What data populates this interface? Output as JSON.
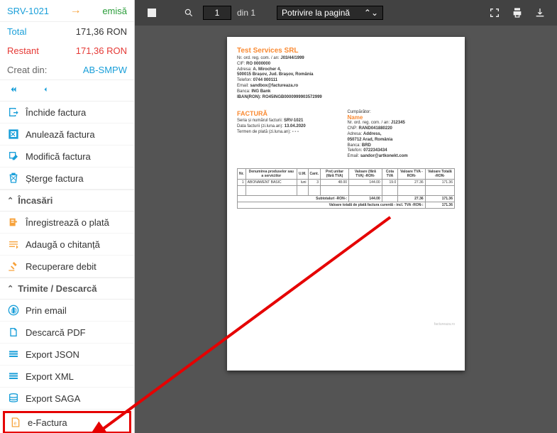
{
  "sidebar": {
    "header": {
      "invoice_no": "SRV-1021",
      "status": "emisă"
    },
    "totals": {
      "total_label": "Total",
      "total_value": "171,36 RON",
      "restant_label": "Restant",
      "restant_value": "171,36 RON",
      "created_label": "Creat din:",
      "created_value": "AB-SMPW"
    },
    "actions": {
      "close": "Închide factura",
      "cancel": "Anulează factura",
      "modify": "Modifică factura",
      "delete": "Șterge factura"
    },
    "section_payments": {
      "title": "Încasări",
      "register": "Înregistrează o plată",
      "receipt": "Adaugă o chitanță",
      "debit": "Recuperare debit"
    },
    "section_send": {
      "title": "Trimite / Descarcă",
      "email": "Prin email",
      "pdf": "Descarcă PDF",
      "json": "Export JSON",
      "xml": "Export XML",
      "saga": "Export SAGA",
      "efactura": "e-Factura"
    }
  },
  "toolbar": {
    "page": "1",
    "page_total": "din 1",
    "zoom": "Potrivire la pagină"
  },
  "invoice": {
    "seller": {
      "name": "Test Services SRL",
      "reg_label": "Nr. ord. reg. com. / an:",
      "reg": "J03/44/1999",
      "cif_label": "CIF:",
      "cif": "RO 0000000",
      "addr_label": "Adresa:",
      "addr": "A. Mirocher 4,",
      "addr2": "500015 Brașov, Jud. Brașov, România",
      "tel_label": "Telefon:",
      "tel": "0744 000111",
      "email_label": "Email:",
      "email": "sandbox@factureaza.ro",
      "bank_label": "Banca:",
      "bank": "ING Bank",
      "iban_label": "IBAN(RON):",
      "iban": "RO45INGB0000999903572999"
    },
    "doc": {
      "title": "FACTURĂ",
      "serial_label": "Seria și numărul facturii:",
      "serial": "SRV-1021",
      "date_label": "Data facturii (zi.luna.an):",
      "date": "13.04.2020",
      "term_label": "Termen de plată (zi.luna.an):",
      "term": "- - -"
    },
    "buyer": {
      "title": "Cumpărător:",
      "name": "Name",
      "reg_label": "Nr. ord. reg. com. / an:",
      "reg": "J12345",
      "cnp_label": "CNP:",
      "cnp": "RAND041880220",
      "addr_label": "Adresa:",
      "addr": "Address,",
      "addr2": "050712 Arad, România",
      "bank_label": "Banca:",
      "bank": "BRD",
      "tel_label": "Telefon:",
      "tel": "0722343434",
      "email_label": "Email:",
      "email": "sandor@artkonekt.com"
    },
    "table": {
      "headers": [
        "Nr.",
        "Denumirea produselor sau a serviciilor",
        "U.M.",
        "Cant.",
        "Preț unitar (fără TVA)",
        "Valoare (fără TVA) -RON-",
        "Cota TVA",
        "Valoare TVA -RON-",
        "Valoare Totală -RON-"
      ],
      "row": {
        "nr": "1",
        "name": "ABONAMENT BASIC",
        "um": "luni",
        "qty": "3",
        "pu": "48.00",
        "val": "144.00",
        "cota": "19.0",
        "tva": "27.36",
        "total": "171.36"
      },
      "subtotal_label": "Subtotaluri -RON-:",
      "subtotal": {
        "val": "144.00",
        "tva": "27.36",
        "total": "171.36"
      },
      "grandtotal_label": "Valoare totală de plată factura curentă - incl. TVA -RON-:",
      "grandtotal_value": "171.36"
    },
    "brand": "factureaza.ro"
  }
}
